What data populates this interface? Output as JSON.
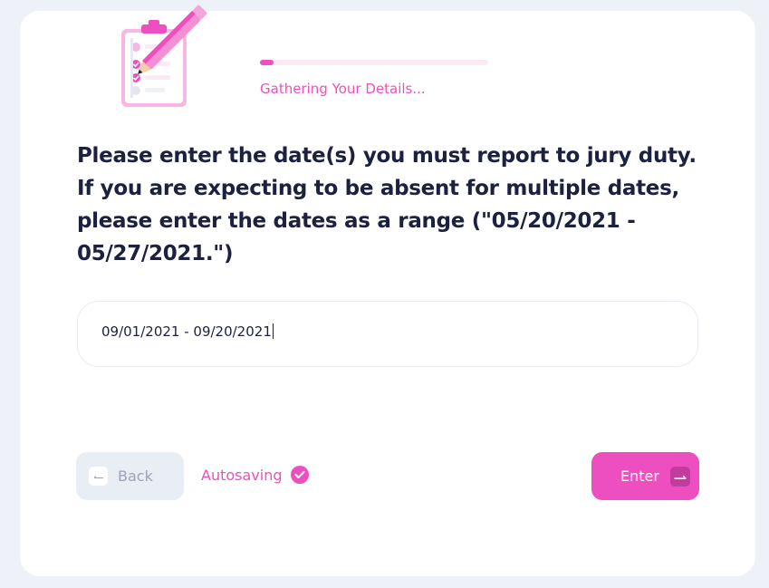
{
  "progress": {
    "label": "Gathering Your Details...",
    "fraction": 0.06
  },
  "question": {
    "text": "Please enter the date(s) you must report to jury duty. If you are expecting to be absent for multiple dates, please enter the dates as a range (\"05/20/2021 - 05/27/2021.\")"
  },
  "answer": {
    "value": "09/01/2021 - 09/20/2021"
  },
  "navigation": {
    "back_label": "Back",
    "autosave_label": "Autosaving",
    "enter_label": "Enter"
  },
  "icons": {
    "illustration": "clipboard-pencil-icon",
    "back": "back-arrow-icon",
    "autosave": "check-circle-icon",
    "enter": "enter-arrow-icon"
  },
  "colors": {
    "accent": "#ee4fc0",
    "text": "#1d2140",
    "muted": "#9aa3b8",
    "background": "#eef1f8"
  }
}
